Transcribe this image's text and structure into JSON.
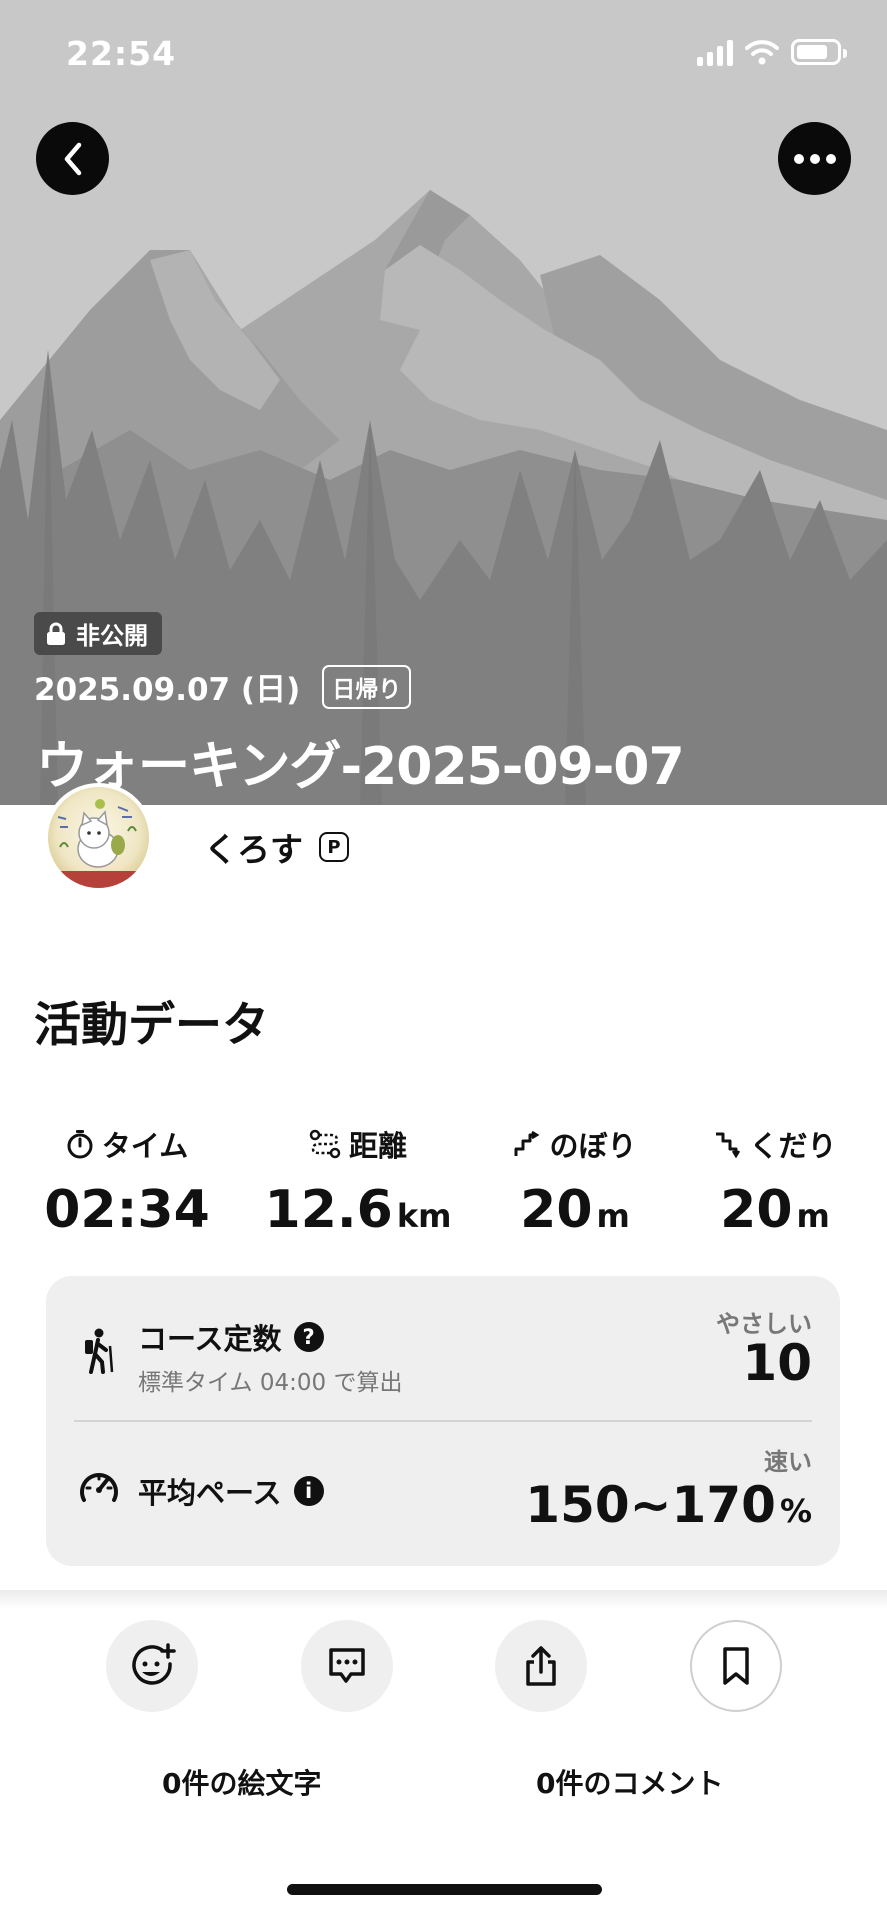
{
  "status_bar": {
    "time": "22:54"
  },
  "hero": {
    "private_label": "非公開",
    "date": "2025.09.07 (日)",
    "trip_type": "日帰り",
    "title": "ウォーキング-2025-09-07"
  },
  "user": {
    "name": "くろす",
    "badge": "P"
  },
  "activity": {
    "section_title": "活動データ",
    "stats": [
      {
        "label": "タイム",
        "value": "02:34",
        "unit": ""
      },
      {
        "label": "距離",
        "value": "12.6",
        "unit": "km"
      },
      {
        "label": "のぼり",
        "value": "20",
        "unit": "m"
      },
      {
        "label": "くだり",
        "value": "20",
        "unit": "m"
      }
    ],
    "course": {
      "title": "コース定数",
      "subtitle": "標準タイム 04:00 で算出",
      "rating": "やさしい",
      "value": "10"
    },
    "pace": {
      "title": "平均ペース",
      "rating": "速い",
      "value": "150~170",
      "unit": "%"
    }
  },
  "bottom": {
    "emoji_count": "0件の絵文字",
    "comment_count": "0件のコメント"
  }
}
